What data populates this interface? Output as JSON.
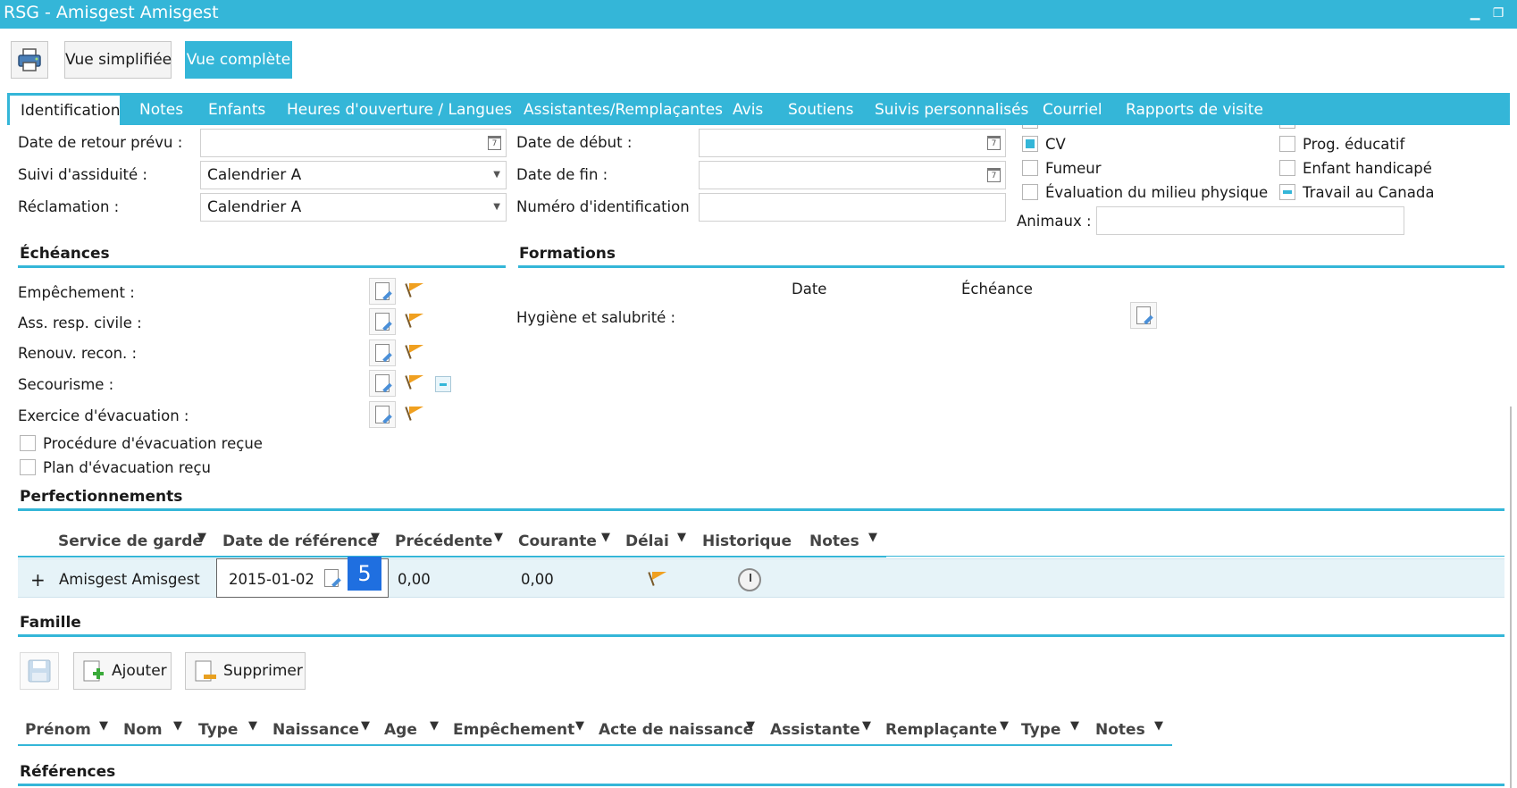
{
  "window": {
    "title": "RSG - Amisgest Amisgest"
  },
  "toolbar": {
    "simple_view": "Vue simplifiée",
    "full_view": "Vue complète"
  },
  "tabs": [
    "Identification",
    "Notes",
    "Enfants",
    "Heures d'ouverture / Langues",
    "Assistantes/Remplaçantes",
    "Avis",
    "Soutiens",
    "Suivis personnalisés",
    "Courriel",
    "Rapports de visite"
  ],
  "form": {
    "return_date_label": "Date de retour prévu :",
    "attendance_label": "Suivi d'assiduité :",
    "attendance_value": "Calendrier A",
    "claim_label": "Réclamation :",
    "claim_value": "Calendrier A",
    "start_date_label": "Date de début :",
    "end_date_label": "Date de fin :",
    "id_number_label": "Numéro d'identification",
    "animals_label": "Animaux :"
  },
  "checks": {
    "cv": "CV",
    "smoker": "Fumeur",
    "env_eval": "Évaluation du milieu physique",
    "edu_prog": "Prog. éducatif",
    "handicapped": "Enfant handicapé",
    "work_canada": "Travail au Canada"
  },
  "deadlines": {
    "title": "Échéances",
    "items": [
      "Empêchement :",
      "Ass. resp. civile :",
      "Renouv. recon. :",
      "Secourisme :",
      "Exercice d'évacuation :"
    ],
    "proc_received": "Procédure d'évacuation reçue",
    "plan_received": "Plan d'évacuation reçu"
  },
  "trainings": {
    "title": "Formations",
    "date_col": "Date",
    "due_col": "Échéance",
    "hygiene": "Hygiène et salubrité :"
  },
  "perf": {
    "title": "Perfectionnements",
    "columns": [
      "Service de garde",
      "Date de référence",
      "Précédente",
      "Courante",
      "Délai",
      "Historique",
      "Notes"
    ],
    "row": {
      "expand": "+",
      "service": "Amisgest Amisgest",
      "ref_date": "2015-01-02",
      "previous": "0,00",
      "current": "0,00"
    },
    "badge": "5"
  },
  "family": {
    "title": "Famille",
    "add": "Ajouter",
    "delete": "Supprimer",
    "columns": [
      "Prénom",
      "Nom",
      "Type",
      "Naissance",
      "Age",
      "Empêchement",
      "Acte de naissance",
      "Assistante",
      "Remplaçante",
      "Type",
      "Notes"
    ]
  },
  "references": {
    "title": "Références"
  }
}
